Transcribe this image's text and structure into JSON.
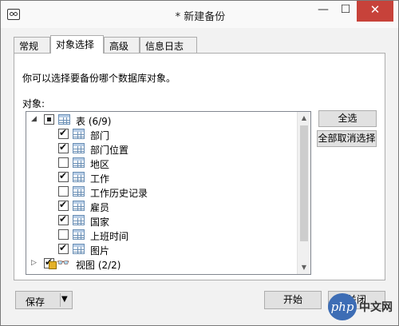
{
  "window": {
    "title": "* 新建备份",
    "min_glyph": "—",
    "max_glyph": "☐",
    "close_glyph": "✕"
  },
  "tabs": [
    {
      "label": "常规",
      "active": false
    },
    {
      "label": "对象选择",
      "active": true
    },
    {
      "label": "高级",
      "active": false
    },
    {
      "label": "信息日志",
      "active": false
    }
  ],
  "panel": {
    "hint": "你可以选择要备份哪个数据库对象。",
    "objects_label": "对象:"
  },
  "tree": {
    "tables_group": {
      "label": "表",
      "count": "(6/9)",
      "expanded": true,
      "state": "partial"
    },
    "tables": [
      {
        "label": "部门",
        "checked": true
      },
      {
        "label": "部门位置",
        "checked": true
      },
      {
        "label": "地区",
        "checked": false
      },
      {
        "label": "工作",
        "checked": true
      },
      {
        "label": "工作历史记录",
        "checked": false
      },
      {
        "label": "雇员",
        "checked": true
      },
      {
        "label": "国家",
        "checked": true
      },
      {
        "label": "上班时间",
        "checked": false
      },
      {
        "label": "图片",
        "checked": true
      }
    ],
    "views_group": {
      "label": "视图",
      "count": "(2/2)",
      "expanded": false,
      "state": "checked"
    }
  },
  "buttons": {
    "select_all": "全选",
    "deselect_all": "全部取消选择",
    "save": "保存",
    "start": "开始",
    "close": "关闭"
  },
  "watermark": {
    "logo": "php",
    "text": "中文网"
  },
  "colors": {
    "close_button": "#c7423a",
    "watermark": "#3d6db5"
  }
}
